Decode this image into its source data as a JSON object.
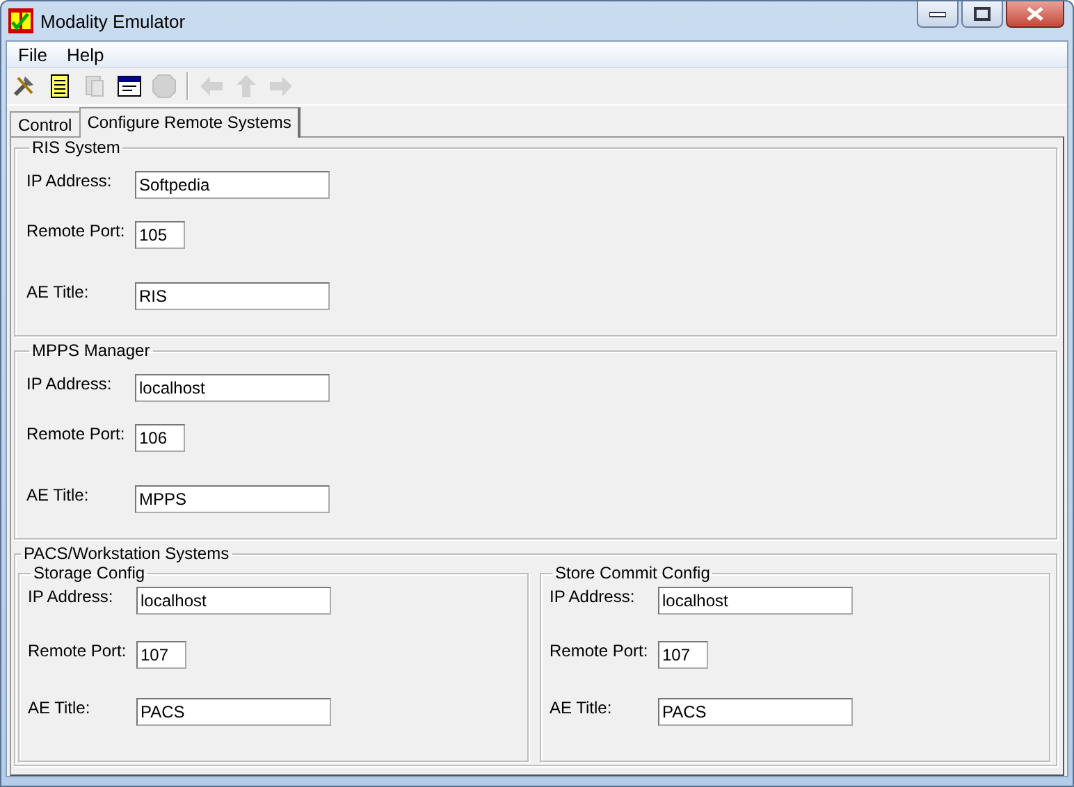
{
  "window": {
    "title": "Modality Emulator"
  },
  "menu": [
    {
      "label": "File"
    },
    {
      "label": "Help"
    }
  ],
  "toolbar": [
    {
      "disabled": false
    },
    {
      "disabled": false
    },
    {
      "disabled": true
    },
    {
      "disabled": false
    },
    {
      "disabled": true
    },
    {
      "disabled": true
    },
    {
      "disabled": true
    },
    {
      "disabled": true
    }
  ],
  "tabs": [
    {
      "label": "Control",
      "selected": false
    },
    {
      "label": "Configure Remote Systems",
      "selected": true
    }
  ],
  "groups": [
    {
      "title": "RIS System",
      "fields": [
        {
          "label": "IP Address:",
          "value": "Softpedia",
          "kind": "wide"
        },
        {
          "label": "Remote Port:",
          "value": "105",
          "kind": "short"
        },
        {
          "label": "AE Title:",
          "value": "RIS",
          "kind": "wide"
        }
      ]
    },
    {
      "title": "MPPS Manager",
      "fields": [
        {
          "label": "IP Address:",
          "value": "localhost",
          "kind": "wide"
        },
        {
          "label": "Remote Port:",
          "value": "106",
          "kind": "short"
        },
        {
          "label": "AE Title:",
          "value": "MPPS",
          "kind": "wide"
        }
      ]
    }
  ],
  "pacs": {
    "title": "PACS/Workstation Systems",
    "groups": [
      {
        "title": "Storage Config",
        "fields": [
          {
            "label": "IP Address:",
            "value": "localhost",
            "kind": "wide"
          },
          {
            "label": "Remote Port:",
            "value": "107",
            "kind": "short"
          },
          {
            "label": "AE Title:",
            "value": "PACS",
            "kind": "wide"
          }
        ]
      },
      {
        "title": "Store Commit Config",
        "fields": [
          {
            "label": "IP Address:",
            "value": "localhost",
            "kind": "wide"
          },
          {
            "label": "Remote Port:",
            "value": "107",
            "kind": "short"
          },
          {
            "label": "AE Title:",
            "value": "PACS",
            "kind": "wide"
          }
        ]
      }
    ]
  }
}
